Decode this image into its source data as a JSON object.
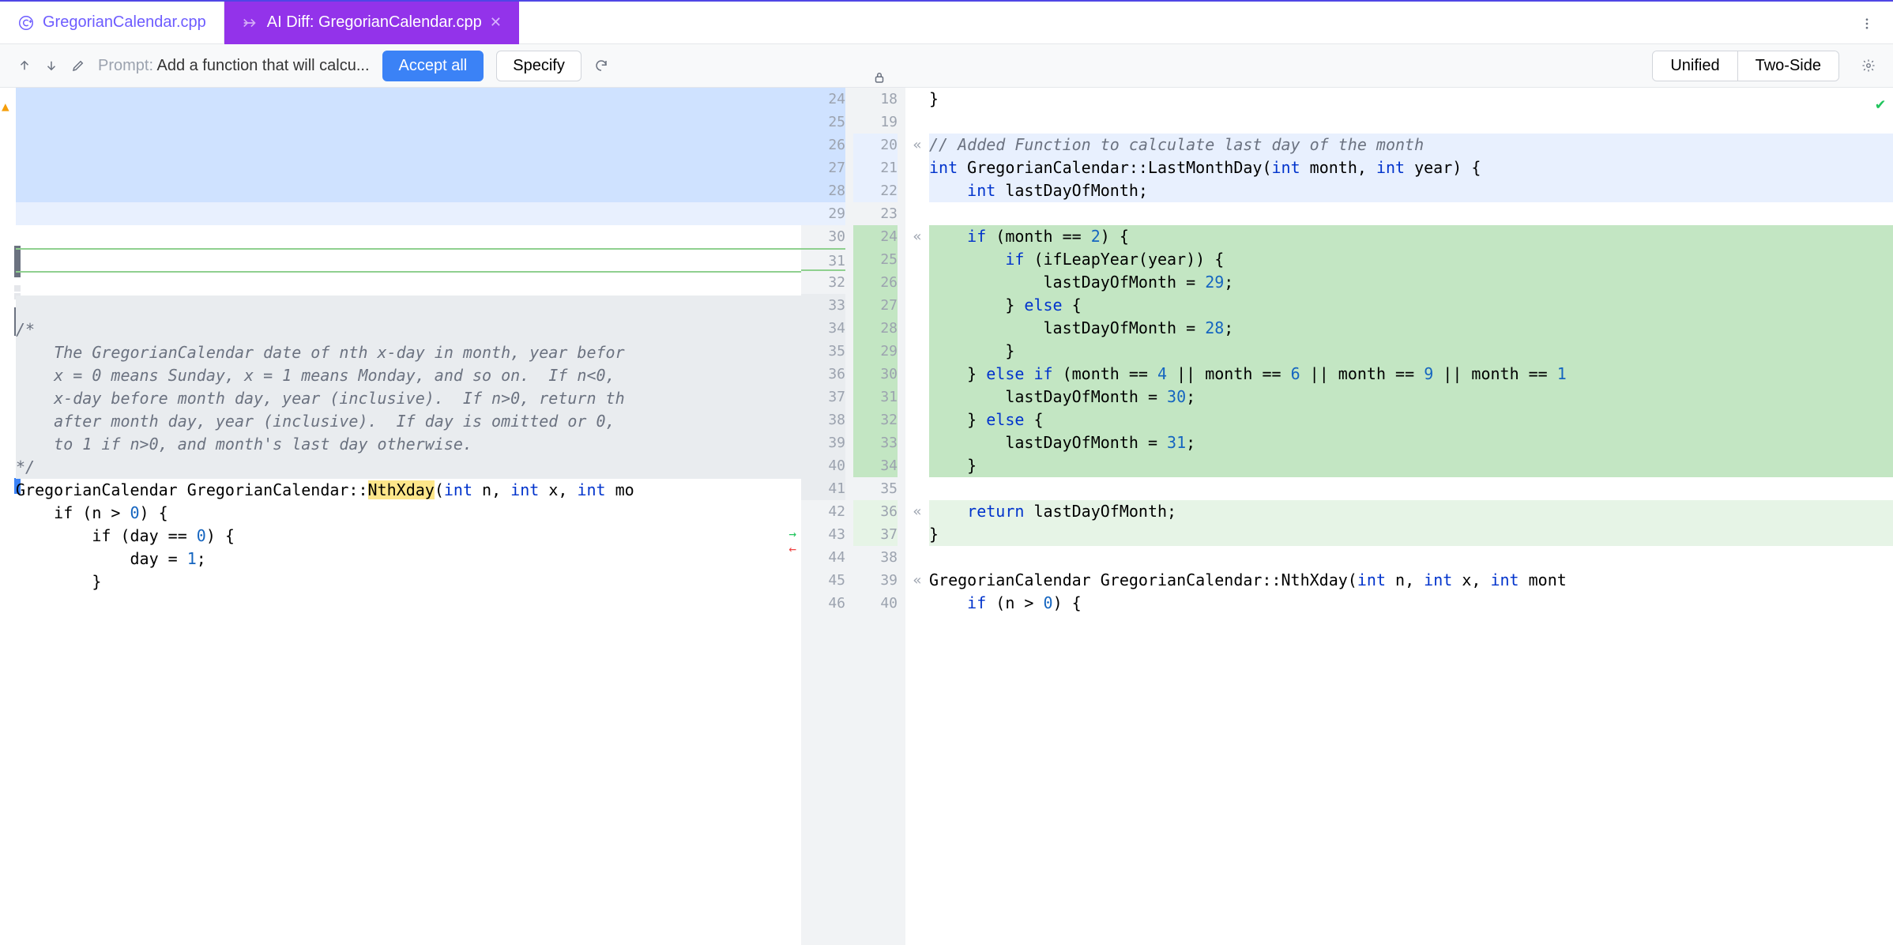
{
  "tabs": {
    "file": "GregorianCalendar.cpp",
    "ai": "AI Diff: GregorianCalendar.cpp"
  },
  "toolbar": {
    "prompt_label": "Prompt: ",
    "prompt_text": "Add a function that will calcu...",
    "accept": "Accept all",
    "specify": "Specify",
    "unified": "Unified",
    "twoside": "Two-Side"
  },
  "left_gutter": [
    "24",
    "25",
    "26",
    "27",
    "28",
    "29",
    "30",
    "31",
    "32",
    "33",
    "34",
    "35",
    "36",
    "37",
    "38",
    "39",
    "40",
    "41",
    "42",
    "43",
    "44",
    "45",
    "46"
  ],
  "right_gutter": [
    "18",
    "19",
    "20",
    "21",
    "22",
    "23",
    "24",
    "25",
    "26",
    "27",
    "28",
    "29",
    "30",
    "31",
    "32",
    "33",
    "34",
    "35",
    "36",
    "37",
    "38",
    "39",
    "40"
  ],
  "chevrons": {
    "r20": "«",
    "r24": "«",
    "r36": "«",
    "r39": "«"
  },
  "left_code": {
    "c_open": "/*",
    "c1": "    The GregorianCalendar date of nth x-day in month, year befor",
    "c2": "    x = 0 means Sunday, x = 1 means Monday, and so on.  If n<0,",
    "c3": "    x-day before month day, year (inclusive).  If n>0, return th",
    "c4": "    after month day, year (inclusive).  If day is omitted or 0,",
    "c5": "    to 1 if n>0, and month's last day otherwise.",
    "c_close": "*/",
    "fn1_a": "GregorianCalendar GregorianCalendar::",
    "fn1_hl": "NthXday",
    "fn1_b": "(",
    "fn1_kw1": "int",
    "fn1_c": " n, ",
    "fn1_kw2": "int",
    "fn1_d": " x, ",
    "fn1_kw3": "int",
    "fn1_e": " mo",
    "if1_a": "    if (n > ",
    "if1_n": "0",
    "if1_b": ") {",
    "if2_a": "        if (day == ",
    "if2_n": "0",
    "if2_b": ") {",
    "asg_a": "            day = ",
    "asg_n": "1",
    "asg_b": ";",
    "brace": "        }"
  },
  "right_code": {
    "l18": "}",
    "l19": "",
    "l20": "// Added Function to calculate last day of the month",
    "l21_a": "int",
    "l21_b": " GregorianCalendar::LastMonthDay(",
    "l21_c": "int",
    "l21_d": " month, ",
    "l21_e": "int",
    "l21_f": " year) {",
    "l22_a": "    ",
    "l22_b": "int",
    "l22_c": " lastDayOfMonth;",
    "l23": "",
    "l24_a": "    ",
    "l24_b": "if",
    "l24_c": " (month == ",
    "l24_n": "2",
    "l24_d": ") {",
    "l25_a": "        ",
    "l25_b": "if",
    "l25_c": " (ifLeapYear(year)) {",
    "l26_a": "            lastDayOfMonth = ",
    "l26_n": "29",
    "l26_b": ";",
    "l27_a": "        } ",
    "l27_b": "else",
    "l27_c": " {",
    "l28_a": "            lastDayOfMonth = ",
    "l28_n": "28",
    "l28_b": ";",
    "l29": "        }",
    "l30_a": "    } ",
    "l30_b": "else if",
    "l30_c": " (month == ",
    "l30_n1": "4",
    "l30_d": " || month == ",
    "l30_n2": "6",
    "l30_e": " || month == ",
    "l30_n3": "9",
    "l30_f": " || month == ",
    "l30_n4": "1",
    "l31_a": "        lastDayOfMonth = ",
    "l31_n": "30",
    "l31_b": ";",
    "l32_a": "    } ",
    "l32_b": "else",
    "l32_c": " {",
    "l33_a": "        lastDayOfMonth = ",
    "l33_n": "31",
    "l33_b": ";",
    "l34": "    }",
    "l35": "",
    "l36_a": "    ",
    "l36_b": "return",
    "l36_c": " lastDayOfMonth;",
    "l37": "}",
    "l38": "",
    "l39_a": "GregorianCalendar GregorianCalendar::NthXday(",
    "l39_b": "int",
    "l39_c": " n, ",
    "l39_d": "int",
    "l39_e": " x, ",
    "l39_f": "int",
    "l39_g": " mont",
    "l40_a": "    ",
    "l40_b": "if",
    "l40_c": " (n > ",
    "l40_n": "0",
    "l40_d": ") {"
  }
}
